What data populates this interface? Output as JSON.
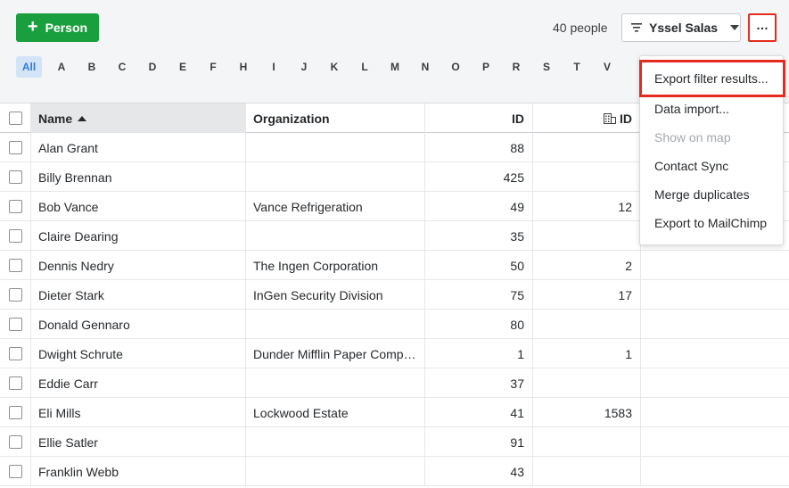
{
  "toolbar": {
    "add_person_label": "Person",
    "people_count": "40 people",
    "filter_label": "Yssel Salas",
    "more_label": "…"
  },
  "alphabet": [
    "All",
    "A",
    "B",
    "C",
    "D",
    "E",
    "F",
    "H",
    "I",
    "J",
    "K",
    "L",
    "M",
    "N",
    "O",
    "P",
    "R",
    "S",
    "T",
    "V"
  ],
  "alphabet_active": "All",
  "table": {
    "columns": {
      "name": "Name",
      "organization": "Organization",
      "id": "ID",
      "org_id": "ID"
    },
    "sort_column": "name",
    "sort_direction": "ascending",
    "rows": [
      {
        "name": "Alan Grant",
        "organization": "",
        "id": "88",
        "org_id": ""
      },
      {
        "name": "Billy Brennan",
        "organization": "",
        "id": "425",
        "org_id": ""
      },
      {
        "name": "Bob Vance",
        "organization": "Vance Refrigeration",
        "id": "49",
        "org_id": "12"
      },
      {
        "name": "Claire Dearing",
        "organization": "",
        "id": "35",
        "org_id": ""
      },
      {
        "name": "Dennis Nedry",
        "organization": "The Ingen Corporation",
        "id": "50",
        "org_id": "2"
      },
      {
        "name": "Dieter Stark",
        "organization": "InGen Security Division",
        "id": "75",
        "org_id": "17"
      },
      {
        "name": "Donald Gennaro",
        "organization": "",
        "id": "80",
        "org_id": ""
      },
      {
        "name": "Dwight Schrute",
        "organization": "Dunder Mifflin Paper Comp…",
        "id": "1",
        "org_id": "1"
      },
      {
        "name": "Eddie Carr",
        "organization": "",
        "id": "37",
        "org_id": ""
      },
      {
        "name": "Eli Mills",
        "organization": "Lockwood Estate",
        "id": "41",
        "org_id": "1583"
      },
      {
        "name": "Ellie Satler",
        "organization": "",
        "id": "91",
        "org_id": ""
      },
      {
        "name": "Franklin Webb",
        "organization": "",
        "id": "43",
        "org_id": ""
      }
    ]
  },
  "dropdown": {
    "items": [
      {
        "label": "Export filter results...",
        "disabled": false,
        "highlighted": true
      },
      {
        "label": "Data import...",
        "disabled": false,
        "highlighted": false
      },
      {
        "label": "Show on map",
        "disabled": true,
        "highlighted": false
      },
      {
        "label": "Contact Sync",
        "disabled": false,
        "highlighted": false
      },
      {
        "label": "Merge duplicates",
        "disabled": false,
        "highlighted": false
      },
      {
        "label": "Export to MailChimp",
        "disabled": false,
        "highlighted": false
      }
    ]
  },
  "icons": {
    "add": "plus-icon",
    "filter": "filter-icon",
    "caret": "chevron-down-icon",
    "more": "ellipsis-icon",
    "sort": "sort-ascending-icon",
    "org_id": "building-icon"
  },
  "colors": {
    "primary_green": "#1a9f3e",
    "highlight_red": "#e52b1f",
    "active_letter_bg": "#d3e4f8",
    "active_letter_text": "#317ae2"
  }
}
